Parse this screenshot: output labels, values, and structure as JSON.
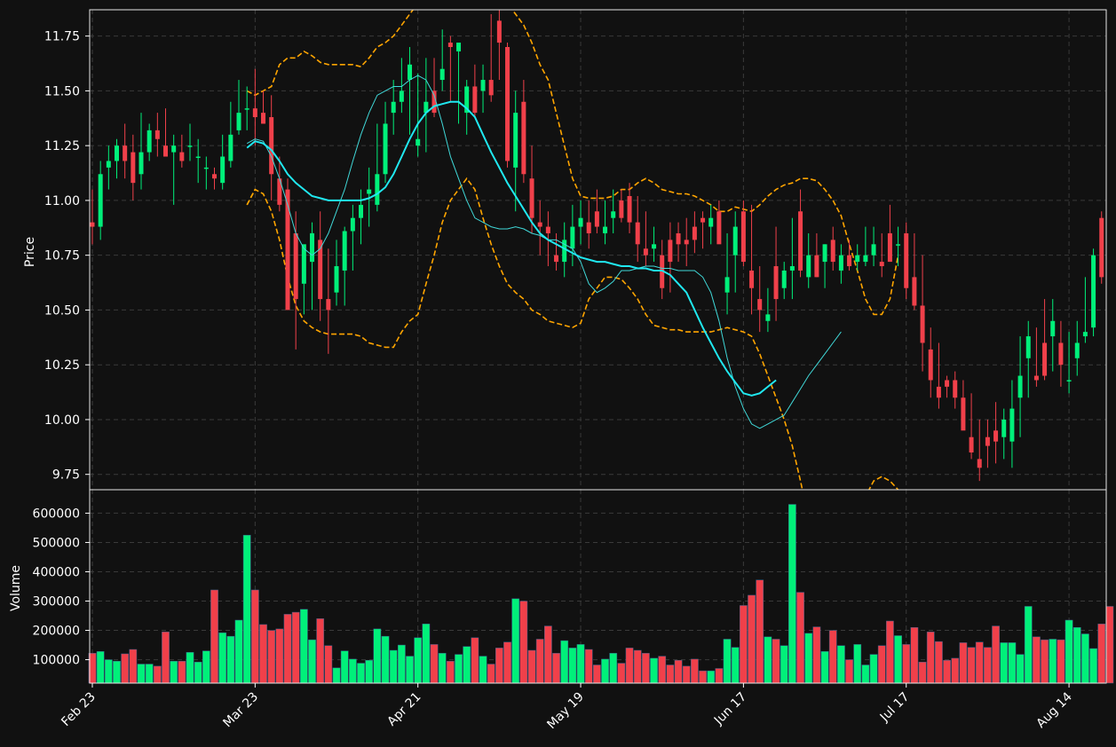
{
  "chart_data": {
    "type": "candlestick",
    "colors": {
      "background": "#111111",
      "up": "#00f07a",
      "down": "#f0404a",
      "bollinger": "#ffa500",
      "ma_fast": "#40d8d8",
      "ma_slow": "#20e8f0",
      "grid": "#3a3a3a"
    },
    "price_panel": {
      "ylabel": "Price",
      "ylim": [
        9.68,
        11.87
      ],
      "yticks": [
        "9.75",
        "10.00",
        "10.25",
        "10.50",
        "10.75",
        "11.00",
        "11.25",
        "11.50",
        "11.75"
      ],
      "grid": true
    },
    "volume_panel": {
      "ylabel": "Volume",
      "ylim": [
        20000,
        680000
      ],
      "yticks": [
        "100000",
        "200000",
        "300000",
        "400000",
        "500000",
        "600000"
      ],
      "grid": true
    },
    "x_ticks": [
      {
        "index": 0,
        "label": "Feb 23"
      },
      {
        "index": 20,
        "label": "Mar 23"
      },
      {
        "index": 40,
        "label": "Apr 21"
      },
      {
        "index": 60,
        "label": "May 19"
      },
      {
        "index": 80,
        "label": "Jun 17"
      },
      {
        "index": 100,
        "label": "Jul 17"
      },
      {
        "index": 120,
        "label": "Aug 14"
      }
    ],
    "series": [
      {
        "kind": "ohlc",
        "open": [
          10.9,
          10.88,
          11.15,
          11.18,
          11.25,
          11.22,
          11.12,
          11.22,
          11.32,
          11.25,
          11.22,
          11.22,
          11.25,
          11.2,
          11.15,
          11.12,
          11.08,
          11.18,
          11.32,
          11.42,
          11.42,
          11.4,
          11.38,
          11.1,
          11.05,
          10.85,
          10.62,
          10.72,
          10.82,
          10.55,
          10.58,
          10.68,
          10.86,
          10.92,
          11.03,
          10.98,
          11.12,
          11.4,
          11.45,
          11.55,
          11.25,
          11.4,
          11.5,
          11.55,
          11.72,
          11.68,
          11.4,
          11.52,
          11.5,
          11.55,
          11.82,
          11.7,
          11.15,
          11.45,
          11.1,
          10.9,
          10.88,
          10.75,
          10.72,
          10.78,
          10.88,
          10.9,
          10.95,
          10.85,
          10.92,
          11.0,
          11.02,
          10.9,
          10.78,
          10.78,
          10.75,
          10.82,
          10.85,
          10.82,
          10.88,
          10.92,
          10.88,
          10.95,
          10.58,
          10.75,
          10.95,
          10.68,
          10.55,
          10.45,
          10.7,
          10.6,
          10.68,
          10.95,
          10.65,
          10.75,
          10.72,
          10.82,
          10.68,
          10.75,
          10.72,
          10.72,
          10.75,
          10.72,
          10.85,
          10.8,
          10.85,
          10.65,
          10.52,
          10.32,
          10.15,
          10.18,
          10.18,
          10.1,
          9.92,
          9.82,
          9.92,
          9.95,
          9.92,
          9.9,
          10.1,
          10.28,
          10.2,
          10.35,
          10.38,
          10.35,
          10.18,
          10.28,
          10.38,
          10.42,
          10.92
        ],
        "high": [
          11.05,
          11.18,
          11.25,
          11.28,
          11.35,
          11.3,
          11.4,
          11.35,
          11.4,
          11.42,
          11.3,
          11.3,
          11.35,
          11.28,
          11.2,
          11.15,
          11.3,
          11.45,
          11.55,
          11.52,
          11.6,
          11.5,
          11.48,
          11.2,
          11.1,
          10.95,
          10.78,
          10.9,
          10.95,
          10.78,
          10.82,
          10.88,
          10.98,
          11.05,
          11.15,
          11.35,
          11.45,
          11.55,
          11.65,
          11.7,
          11.58,
          11.65,
          11.65,
          11.78,
          11.75,
          11.7,
          11.55,
          11.62,
          11.62,
          11.85,
          11.9,
          11.72,
          11.5,
          11.55,
          11.25,
          11.0,
          10.95,
          10.85,
          10.9,
          10.98,
          11.0,
          11.0,
          11.05,
          11.0,
          11.05,
          11.05,
          11.08,
          11.02,
          10.95,
          10.88,
          10.82,
          10.9,
          10.9,
          10.92,
          10.95,
          10.95,
          10.98,
          11.0,
          10.85,
          10.95,
          11.0,
          10.98,
          10.7,
          10.6,
          10.88,
          10.72,
          10.92,
          11.05,
          10.85,
          10.85,
          10.8,
          10.88,
          10.8,
          10.82,
          10.8,
          10.88,
          10.88,
          10.85,
          10.98,
          10.88,
          10.9,
          10.85,
          10.75,
          10.42,
          10.35,
          10.2,
          10.22,
          10.18,
          10.12,
          10.0,
          10.0,
          10.08,
          10.05,
          10.18,
          10.38,
          10.45,
          10.42,
          10.55,
          10.55,
          10.45,
          10.4,
          10.45,
          10.65,
          10.78,
          10.95
        ],
        "low": [
          10.8,
          10.82,
          11.05,
          11.1,
          11.1,
          11.0,
          11.05,
          11.18,
          11.2,
          11.2,
          10.98,
          11.15,
          11.18,
          11.08,
          11.05,
          11.05,
          11.05,
          11.15,
          11.3,
          11.32,
          11.25,
          11.35,
          11.0,
          10.95,
          10.5,
          10.32,
          10.48,
          10.5,
          10.45,
          10.3,
          10.52,
          10.52,
          10.68,
          10.8,
          10.88,
          10.95,
          11.08,
          11.3,
          11.4,
          11.3,
          11.2,
          11.22,
          11.38,
          11.5,
          11.45,
          11.35,
          11.3,
          11.38,
          11.4,
          11.45,
          11.55,
          11.15,
          10.95,
          11.08,
          10.85,
          10.75,
          10.7,
          10.68,
          10.65,
          10.7,
          10.8,
          10.78,
          10.85,
          10.8,
          10.85,
          10.9,
          10.85,
          10.72,
          10.7,
          10.72,
          10.55,
          10.58,
          10.72,
          10.7,
          10.76,
          10.78,
          10.8,
          10.82,
          10.48,
          10.58,
          10.7,
          10.48,
          10.4,
          10.4,
          10.45,
          10.55,
          10.55,
          10.65,
          10.6,
          10.65,
          10.6,
          10.68,
          10.62,
          10.68,
          10.68,
          10.7,
          10.7,
          10.65,
          10.72,
          10.7,
          10.55,
          10.5,
          10.22,
          10.1,
          10.05,
          10.1,
          10.05,
          10.0,
          9.82,
          9.72,
          9.78,
          9.8,
          9.82,
          9.78,
          9.92,
          10.1,
          10.15,
          10.18,
          10.22,
          10.15,
          10.12,
          10.2,
          10.35,
          10.38,
          10.62
        ],
        "close": [
          10.88,
          11.12,
          11.18,
          11.25,
          11.18,
          11.08,
          11.22,
          11.32,
          11.28,
          11.2,
          11.25,
          11.18,
          11.25,
          11.2,
          11.15,
          11.1,
          11.2,
          11.3,
          11.4,
          11.42,
          11.38,
          11.35,
          11.12,
          10.98,
          10.5,
          10.55,
          10.8,
          10.85,
          10.55,
          10.5,
          10.7,
          10.86,
          10.92,
          10.98,
          11.05,
          11.12,
          11.35,
          11.45,
          11.5,
          11.62,
          11.28,
          11.45,
          11.4,
          11.6,
          11.7,
          11.72,
          11.52,
          11.4,
          11.55,
          11.48,
          11.72,
          11.18,
          11.4,
          11.12,
          10.92,
          10.88,
          10.85,
          10.72,
          10.82,
          10.88,
          10.92,
          10.85,
          10.88,
          10.88,
          10.95,
          10.92,
          10.9,
          10.8,
          10.75,
          10.8,
          10.6,
          10.72,
          10.8,
          10.8,
          10.82,
          10.9,
          10.92,
          10.8,
          10.65,
          10.88,
          10.72,
          10.6,
          10.5,
          10.48,
          10.55,
          10.68,
          10.7,
          10.68,
          10.75,
          10.65,
          10.8,
          10.72,
          10.75,
          10.7,
          10.75,
          10.75,
          10.8,
          10.7,
          10.72,
          10.8,
          10.6,
          10.52,
          10.35,
          10.18,
          10.1,
          10.15,
          10.1,
          9.95,
          9.85,
          9.78,
          9.88,
          9.9,
          10.0,
          10.05,
          10.2,
          10.38,
          10.18,
          10.2,
          10.45,
          10.25,
          10.18,
          10.35,
          10.4,
          10.75,
          10.65
        ]
      },
      {
        "kind": "line",
        "role": "bollinger_upper",
        "start": 19,
        "values": [
          11.5,
          11.48,
          11.5,
          11.52,
          11.62,
          11.65,
          11.65,
          11.68,
          11.66,
          11.63,
          11.62,
          11.62,
          11.62,
          11.62,
          11.61,
          11.65,
          11.7,
          11.72,
          11.75,
          11.8,
          11.85,
          11.9,
          11.95,
          12.02,
          12.08,
          12.1,
          12.12,
          12.12,
          12.1,
          12.05,
          12.0,
          11.95,
          11.9,
          11.85,
          11.8,
          11.72,
          11.62,
          11.55,
          11.4,
          11.25,
          11.1,
          11.02,
          11.01,
          11.01,
          11.01,
          11.02,
          11.05,
          11.05,
          11.08,
          11.1,
          11.08,
          11.05,
          11.04,
          11.03,
          11.03,
          11.02,
          11.0,
          10.98,
          10.95,
          10.95,
          10.97,
          10.96,
          10.95,
          10.98,
          11.02,
          11.05,
          11.07,
          11.08,
          11.1,
          11.1,
          11.09,
          11.05,
          11.0,
          10.93,
          10.8,
          10.68,
          10.55,
          10.48,
          10.48,
          10.55,
          10.75
        ],
        "extra": [
          {
            "index": 12,
            "value": 10.98
          }
        ]
      },
      {
        "kind": "line",
        "role": "bollinger_lower",
        "start": 19,
        "values": [
          10.98,
          11.05,
          11.03,
          10.95,
          10.82,
          10.65,
          10.52,
          10.45,
          10.42,
          10.4,
          10.39,
          10.39,
          10.39,
          10.39,
          10.38,
          10.35,
          10.34,
          10.33,
          10.33,
          10.4,
          10.45,
          10.48,
          10.62,
          10.75,
          10.9,
          11.0,
          11.05,
          11.1,
          11.05,
          10.92,
          10.8,
          10.7,
          10.62,
          10.58,
          10.55,
          10.5,
          10.48,
          10.45,
          10.44,
          10.43,
          10.42,
          10.44,
          10.55,
          10.6,
          10.65,
          10.65,
          10.64,
          10.6,
          10.55,
          10.48,
          10.43,
          10.42,
          10.41,
          10.41,
          10.4,
          10.4,
          10.4,
          10.4,
          10.41,
          10.42,
          10.41,
          10.4,
          10.38,
          10.3,
          10.2,
          10.1,
          10.0,
          9.88,
          9.72,
          9.55,
          9.4,
          9.3,
          9.25,
          9.28,
          9.35,
          9.5,
          9.65,
          9.72,
          9.74,
          9.72,
          9.68
        ]
      },
      {
        "kind": "line",
        "role": "ma_fast",
        "start": 19,
        "values": [
          11.26,
          11.28,
          11.27,
          11.2,
          11.1,
          10.98,
          10.85,
          10.78,
          10.75,
          10.78,
          10.85,
          10.95,
          11.05,
          11.18,
          11.3,
          11.4,
          11.48,
          11.5,
          11.52,
          11.52,
          11.55,
          11.57,
          11.55,
          11.48,
          11.35,
          11.2,
          11.1,
          11.0,
          10.92,
          10.9,
          10.88,
          10.87,
          10.87,
          10.88,
          10.87,
          10.85,
          10.84,
          10.82,
          10.82,
          10.8,
          10.78,
          10.72,
          10.62,
          10.58,
          10.6,
          10.63,
          10.68,
          10.68,
          10.69,
          10.7,
          10.7,
          10.69,
          10.69,
          10.68,
          10.68,
          10.68,
          10.65,
          10.58,
          10.45,
          10.28,
          10.15,
          10.05,
          9.98,
          9.96,
          9.98,
          10.0,
          10.02,
          10.08,
          10.14,
          10.2,
          10.25,
          10.3,
          10.35,
          10.4
        ]
      },
      {
        "kind": "line",
        "role": "ma_slow",
        "start": 19,
        "values": [
          11.24,
          11.27,
          11.26,
          11.23,
          11.18,
          11.12,
          11.08,
          11.05,
          11.02,
          11.01,
          11.0,
          11.0,
          11.0,
          11.0,
          11.0,
          11.01,
          11.03,
          11.06,
          11.12,
          11.2,
          11.28,
          11.35,
          11.4,
          11.43,
          11.44,
          11.45,
          11.45,
          11.42,
          11.38,
          11.3,
          11.22,
          11.15,
          11.08,
          11.02,
          10.96,
          10.9,
          10.85,
          10.82,
          10.8,
          10.78,
          10.76,
          10.74,
          10.73,
          10.72,
          10.72,
          10.71,
          10.7,
          10.7,
          10.69,
          10.69,
          10.68,
          10.68,
          10.66,
          10.62,
          10.58,
          10.5,
          10.42,
          10.35,
          10.28,
          10.22,
          10.17,
          10.12,
          10.11,
          10.12,
          10.15,
          10.18
        ]
      },
      {
        "kind": "bar",
        "role": "volume",
        "values": [
          122000,
          128000,
          100000,
          95000,
          120000,
          135000,
          85000,
          85000,
          78000,
          195000,
          95000,
          95000,
          125000,
          92000,
          130000,
          338000,
          192000,
          180000,
          235000,
          525000,
          338000,
          220000,
          200000,
          205000,
          255000,
          262000,
          272000,
          168000,
          240000,
          148000,
          72000,
          130000,
          102000,
          88000,
          98000,
          205000,
          180000,
          132000,
          150000,
          112000,
          175000,
          222000,
          152000,
          122000,
          95000,
          118000,
          145000,
          175000,
          112000,
          85000,
          140000,
          160000,
          308000,
          300000,
          132000,
          170000,
          215000,
          122000,
          165000,
          140000,
          152000,
          135000,
          82000,
          102000,
          122000,
          88000,
          140000,
          132000,
          122000,
          105000,
          112000,
          82000,
          98000,
          78000,
          102000,
          62000,
          62000,
          70000,
          170000,
          142000,
          285000,
          320000,
          372000,
          178000,
          170000,
          148000,
          630000,
          330000,
          190000,
          212000,
          128000,
          200000,
          148000,
          100000,
          152000,
          82000,
          118000,
          148000,
          232000,
          182000,
          152000,
          210000,
          92000,
          195000,
          162000,
          98000,
          105000,
          158000,
          142000,
          160000,
          142000,
          215000,
          158000,
          158000,
          118000,
          282000,
          178000,
          168000,
          170000,
          168000,
          235000,
          210000,
          188000,
          138000,
          222000,
          282000
        ]
      }
    ]
  }
}
